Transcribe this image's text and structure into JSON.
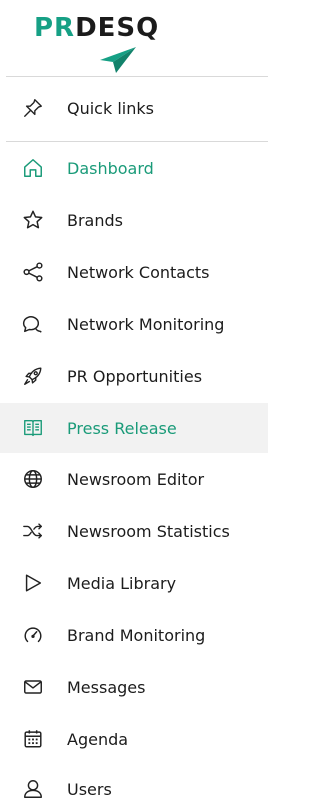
{
  "brand": {
    "logo_prefix": "PR",
    "logo_suffix": "DESQ",
    "accent_color": "#16a085",
    "icon": "paper-plane-icon"
  },
  "quick_links": {
    "label": "Quick links",
    "icon": "pin-icon"
  },
  "nav": {
    "items": [
      {
        "label": "Dashboard",
        "icon": "home-icon",
        "state": "current"
      },
      {
        "label": "Brands",
        "icon": "star-icon"
      },
      {
        "label": "Network Contacts",
        "icon": "share-icon"
      },
      {
        "label": "Network Monitoring",
        "icon": "chat-bubbles-icon"
      },
      {
        "label": "PR Opportunities",
        "icon": "rocket-icon"
      },
      {
        "label": "Press Release",
        "icon": "open-book-icon",
        "state": "highlighted"
      },
      {
        "label": "Newsroom Editor",
        "icon": "globe-icon"
      },
      {
        "label": "Newsroom Statistics",
        "icon": "shuffle-icon"
      },
      {
        "label": "Media Library",
        "icon": "play-icon"
      },
      {
        "label": "Brand Monitoring",
        "icon": "gauge-icon"
      },
      {
        "label": "Messages",
        "icon": "envelope-icon"
      },
      {
        "label": "Agenda",
        "icon": "calendar-icon"
      },
      {
        "label": "Users",
        "icon": "user-icon"
      }
    ]
  }
}
